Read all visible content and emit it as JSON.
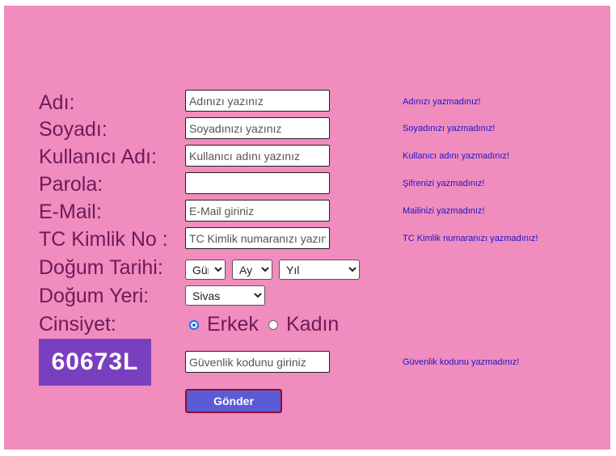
{
  "form": {
    "fields": [
      {
        "label": "Adı:",
        "placeholder": "Adınızı yazınız",
        "error": "Adınızı yazmadınız!"
      },
      {
        "label": "Soyadı:",
        "placeholder": "Soyadınızı yazınız",
        "error": "Soyadınızı yazmadınız!"
      },
      {
        "label": "Kullanıcı Adı:",
        "placeholder": "Kullanıcı adını yazınız",
        "error": "Kullanıcı adını yazmadınız!"
      },
      {
        "label": "Parola:",
        "placeholder": "",
        "error": "Şifrenizi yazmadınız!"
      },
      {
        "label": "E-Mail:",
        "placeholder": "E-Mail giriniz",
        "error": "Mailinizi yazmadınız!"
      },
      {
        "label": "TC Kimlik No :",
        "placeholder": "TC Kimlik numaranızı yazınız",
        "error": "TC Kimlik numaranızı yazmadınız!"
      }
    ],
    "birth_date": {
      "label": "Doğum Tarihi:",
      "day": "Gün",
      "month": "Ay",
      "year": "Yıl"
    },
    "birth_place": {
      "label": "Doğum Yeri:",
      "selected": "Sivas"
    },
    "gender": {
      "label": "Cinsiyet:",
      "options": [
        "Erkek",
        "Kadın"
      ],
      "selected": "Erkek"
    },
    "captcha": {
      "code": "60673L",
      "placeholder": "Güvenlik kodunu giriniz",
      "error": "Güvenlik kodunu yazmadınız!"
    },
    "submit_label": "Gönder"
  },
  "colors": {
    "background": "#f08cbe",
    "label": "#6e1a5a",
    "error": "#1b16c7",
    "captcha_bg": "#7a3fbf",
    "button_bg": "#5b5bd6",
    "button_border": "#8b1030"
  }
}
